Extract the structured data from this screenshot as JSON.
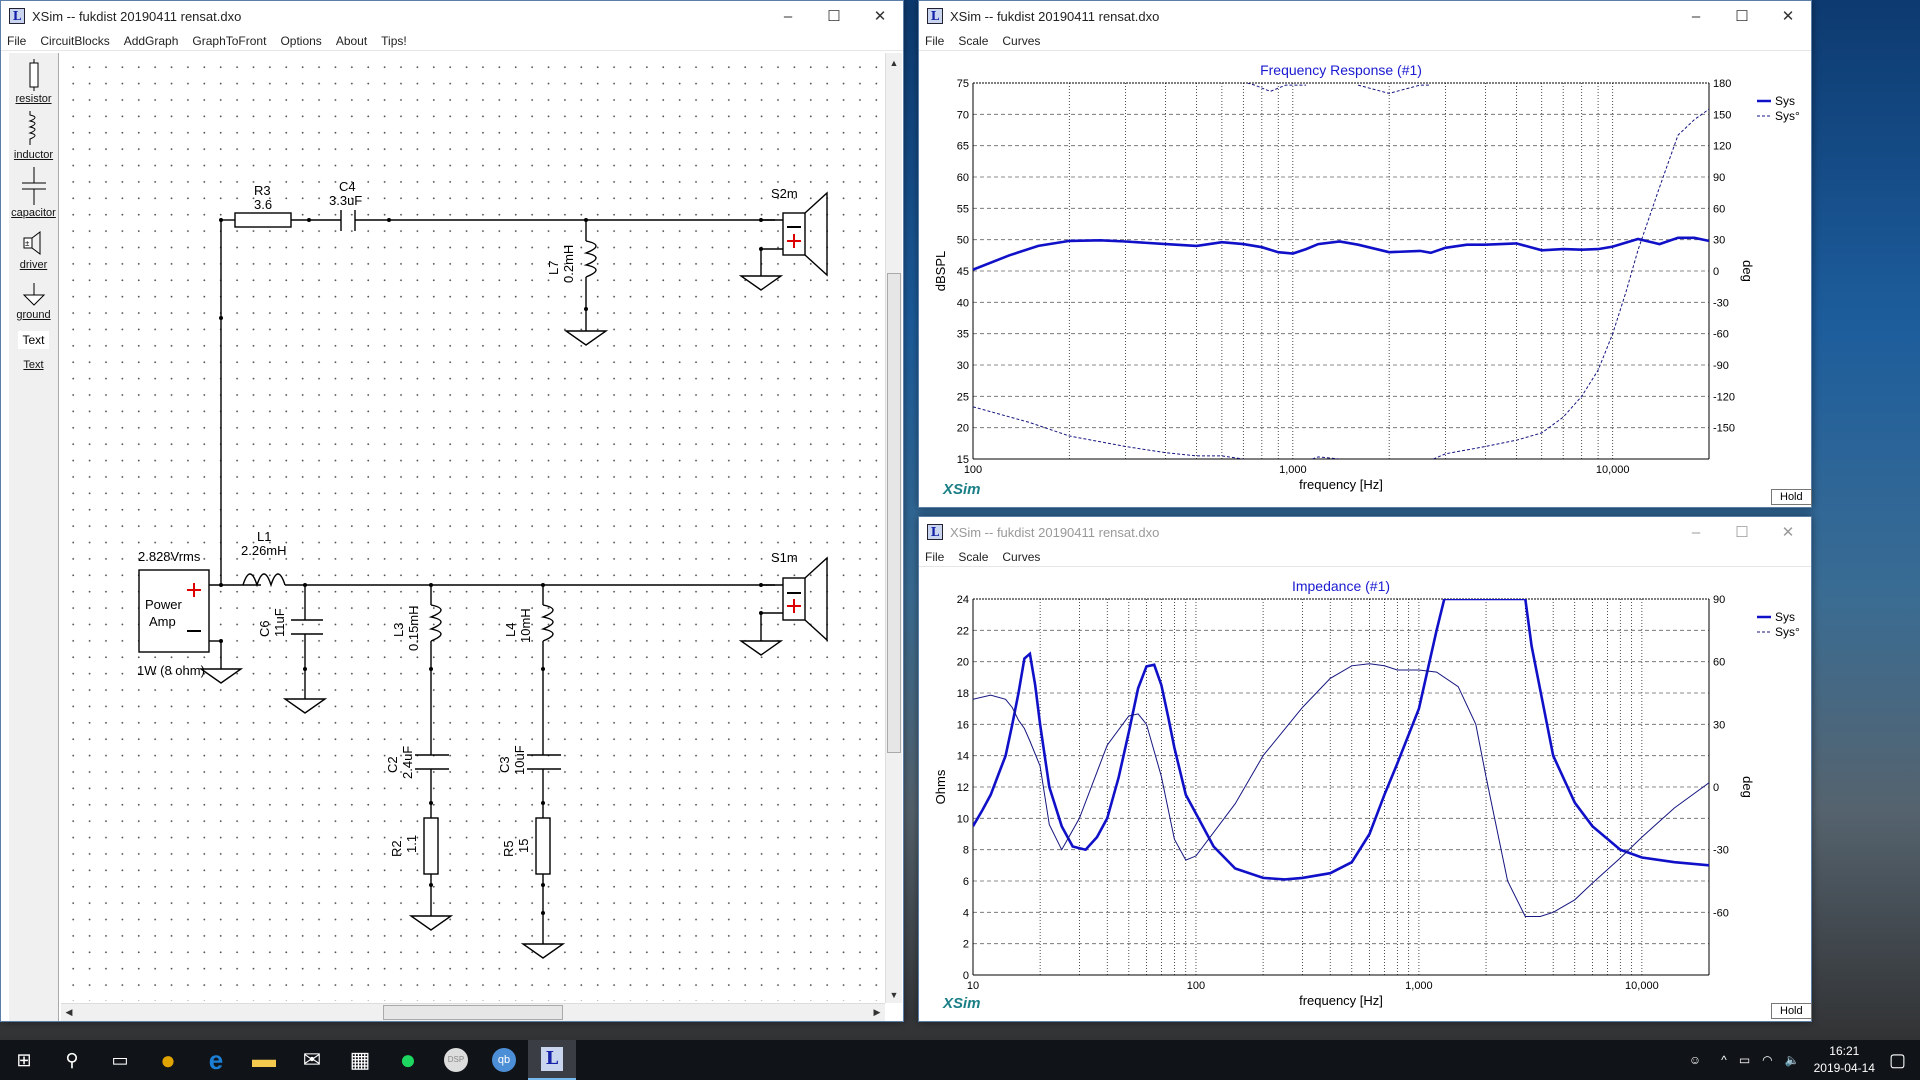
{
  "main_window": {
    "title": "XSim -- fukdist 20190411 rensat.dxo",
    "controls": {
      "minimize": "–",
      "maximize": "☐",
      "close": "✕"
    },
    "menu": [
      "File",
      "CircuitBlocks",
      "AddGraph",
      "GraphToFront",
      "Options",
      "About",
      "Tips!"
    ],
    "toolbox": [
      {
        "label": "resistor",
        "icon": "resistor-icon"
      },
      {
        "label": "inductor",
        "icon": "inductor-icon"
      },
      {
        "label": "capacitor",
        "icon": "capacitor-icon"
      },
      {
        "label": "driver",
        "icon": "driver-icon"
      },
      {
        "label": "ground",
        "icon": "ground-icon"
      },
      {
        "label": "Text",
        "icon": "text-box-icon"
      },
      {
        "label": "Text",
        "icon": "text-link"
      }
    ],
    "schematic": {
      "source": {
        "voltage": "2.828Vrms",
        "name_line1": "Power",
        "name_line2": "Amp",
        "rating": "1W (8 ohm)",
        "plus": "+",
        "minus": "–"
      },
      "components": {
        "R3": {
          "name": "R3",
          "value": "3.6"
        },
        "C4": {
          "name": "C4",
          "value": "3.3uF"
        },
        "L7": {
          "name": "L7",
          "value": "0.2mH"
        },
        "L1": {
          "name": "L1",
          "value": "2.26mH"
        },
        "C6": {
          "name": "C6",
          "value": "11uF"
        },
        "L3": {
          "name": "L3",
          "value": "0.15mH"
        },
        "L4": {
          "name": "L4",
          "value": "10mH"
        },
        "C2": {
          "name": "C2",
          "value": "2.4uF"
        },
        "C3": {
          "name": "C3",
          "value": "10uF"
        },
        "R2": {
          "name": "R2",
          "value": "1.1"
        },
        "R5": {
          "name": "R5",
          "value": "15"
        }
      },
      "drivers": {
        "S2m": "S2m",
        "S1m": "S1m"
      }
    },
    "scroll": {
      "up": "▲",
      "down": "▼",
      "left": "◀",
      "right": "▶"
    }
  },
  "freq_window": {
    "title": "XSim -- fukdist 20190411 rensat.dxo",
    "controls": {
      "minimize": "–",
      "maximize": "☐",
      "close": "✕"
    },
    "menu": [
      "File",
      "Scale",
      "Curves"
    ],
    "hold_label": "Hold",
    "brand": "XSim"
  },
  "imp_window": {
    "title": "XSim -- fukdist 20190411 rensat.dxo",
    "controls": {
      "minimize": "–",
      "maximize": "☐",
      "close": "✕"
    },
    "menu": [
      "File",
      "Scale",
      "Curves"
    ],
    "hold_label": "Hold",
    "brand": "XSim"
  },
  "chart_data": [
    {
      "type": "line",
      "title": "Frequency Response (#1)",
      "xlabel": "frequency [Hz]",
      "ylabel": "dBSPL",
      "y2label": "deg",
      "xscale": "log",
      "xlim": [
        100,
        20000
      ],
      "ylim": [
        15,
        75
      ],
      "y2lim": [
        -180,
        180
      ],
      "x_ticks": [
        "100",
        "1,000",
        "10,000"
      ],
      "y_ticks": [
        15,
        20,
        25,
        30,
        35,
        40,
        45,
        50,
        55,
        60,
        65,
        70,
        75
      ],
      "y2_ticks": [
        -150,
        -120,
        -90,
        -60,
        -30,
        0,
        30,
        60,
        90,
        120,
        150,
        180
      ],
      "grid": true,
      "legend": {
        "position": "top-right",
        "entries": [
          "Sys",
          "Sys°"
        ]
      },
      "series": [
        {
          "name": "Sys",
          "axis": "left",
          "style": "solid-thick",
          "x": [
            100,
            130,
            160,
            200,
            250,
            300,
            400,
            500,
            600,
            700,
            800,
            900,
            1000,
            1100,
            1200,
            1400,
            1600,
            2000,
            2500,
            2700,
            3000,
            3500,
            4000,
            5000,
            6000,
            7000,
            8000,
            9000,
            10000,
            12000,
            14000,
            16000,
            18000,
            20000
          ],
          "y": [
            45.2,
            47.5,
            49,
            49.8,
            49.9,
            49.7,
            49.3,
            49,
            49.6,
            49.3,
            48.8,
            48,
            47.8,
            48.5,
            49.3,
            49.7,
            49.2,
            48,
            48.2,
            47.9,
            48.7,
            49.2,
            49.2,
            49.4,
            48.3,
            48.5,
            48.4,
            48.5,
            48.9,
            50.1,
            49.3,
            50.3,
            50.3,
            49.8
          ]
        },
        {
          "name": "Sys°",
          "axis": "right",
          "style": "dashed-thin",
          "x": [
            100,
            150,
            200,
            300,
            400,
            500,
            600,
            700,
            720,
            760,
            850,
            950,
            1100,
            1150,
            1200,
            1400,
            1600,
            2000,
            2500,
            2700,
            2750,
            3000,
            4000,
            5000,
            6000,
            7000,
            8000,
            9000,
            10000,
            11000,
            12000,
            14000,
            16000,
            18000,
            20000
          ],
          "y": [
            -130,
            -145,
            -158,
            -168,
            -174,
            -177,
            -177,
            -180,
            180,
            178,
            172,
            178,
            178,
            -180,
            -178,
            -180,
            178,
            170,
            178,
            178,
            -180,
            -175,
            -168,
            -162,
            -155,
            -140,
            -120,
            -95,
            -60,
            -20,
            20,
            80,
            130,
            145,
            155
          ]
        }
      ]
    },
    {
      "type": "line",
      "title": "Impedance (#1)",
      "xlabel": "frequency [Hz]",
      "ylabel": "Ohms",
      "y2label": "deg",
      "xscale": "log",
      "xlim": [
        10,
        20000
      ],
      "ylim": [
        0,
        24
      ],
      "y2lim": [
        -90,
        90
      ],
      "x_ticks": [
        "10",
        "100",
        "1,000",
        "10,000"
      ],
      "y_ticks": [
        0,
        2,
        4,
        6,
        8,
        10,
        12,
        14,
        16,
        18,
        20,
        22,
        24
      ],
      "y2_ticks": [
        -60,
        -30,
        0,
        30,
        60,
        90
      ],
      "grid": true,
      "legend": {
        "position": "top-right",
        "entries": [
          "Sys",
          "Sys°"
        ]
      },
      "series": [
        {
          "name": "Sys",
          "axis": "left",
          "style": "solid-thick",
          "x": [
            10,
            11,
            12,
            13,
            14,
            15,
            16,
            17,
            18,
            19,
            20,
            22,
            25,
            28,
            32,
            36,
            40,
            45,
            50,
            55,
            60,
            65,
            70,
            75,
            80,
            90,
            100,
            120,
            150,
            200,
            250,
            300,
            400,
            500,
            600,
            700,
            800,
            1000,
            1200,
            1300,
            3000,
            3200,
            4000,
            5000,
            6000,
            8000,
            10000,
            14000,
            20000
          ],
          "y": [
            9.5,
            10.5,
            11.5,
            12.8,
            14,
            16,
            18,
            20.2,
            20.5,
            18.5,
            16,
            12,
            9.5,
            8.2,
            8,
            8.8,
            10,
            12.6,
            15.5,
            18.3,
            19.7,
            19.8,
            18.5,
            16.5,
            14.5,
            11.5,
            10.3,
            8.2,
            6.8,
            6.2,
            6.1,
            6.2,
            6.5,
            7.2,
            9,
            11.5,
            13.5,
            17,
            22,
            24,
            24,
            21,
            14,
            11,
            9.5,
            8,
            7.5,
            7.2,
            7.0
          ]
        },
        {
          "name": "Sys°",
          "axis": "right",
          "style": "solid-thin",
          "x": [
            10,
            12,
            14,
            15,
            16,
            17,
            18,
            20,
            22,
            25,
            30,
            40,
            50,
            55,
            60,
            70,
            80,
            90,
            100,
            150,
            200,
            300,
            400,
            500,
            600,
            700,
            800,
            1000,
            1200,
            1500,
            1800,
            2000,
            2500,
            3000,
            3500,
            4000,
            5000,
            6000,
            8000,
            10000,
            14000,
            20000
          ],
          "y": [
            42,
            44,
            42,
            38,
            32,
            28,
            22,
            10,
            -18,
            -30,
            -15,
            20,
            34,
            35,
            30,
            5,
            -25,
            -35,
            -33,
            -8,
            15,
            38,
            52,
            58,
            59,
            58,
            56,
            56,
            55,
            48,
            30,
            5,
            -45,
            -62,
            -62,
            -60,
            -54,
            -46,
            -34,
            -24,
            -10,
            2
          ]
        }
      ]
    }
  ],
  "taskbar": {
    "items": [
      {
        "name": "start-button",
        "glyph": "⊞"
      },
      {
        "name": "search-button",
        "glyph": "⚲"
      },
      {
        "name": "task-view-button",
        "glyph": "▭"
      },
      {
        "name": "chrome-app",
        "glyph": "●"
      },
      {
        "name": "edge-app",
        "glyph": "e"
      },
      {
        "name": "file-explorer-app",
        "glyph": "▬"
      },
      {
        "name": "mail-app",
        "glyph": "✉"
      },
      {
        "name": "store-app",
        "glyph": "▦"
      },
      {
        "name": "spotify-app",
        "glyph": "●"
      },
      {
        "name": "dsp-app",
        "glyph": "DSP"
      },
      {
        "name": "qbittorrent-app",
        "glyph": "qb"
      },
      {
        "name": "xsim-app",
        "glyph": "L"
      }
    ],
    "time": "16:21",
    "date": "2019-04-14",
    "tray_glyphs": {
      "people": "☺",
      "chevron": "^",
      "battery": "▭",
      "wifi": "◠",
      "volume": "🔈",
      "notifications": "▢"
    }
  }
}
